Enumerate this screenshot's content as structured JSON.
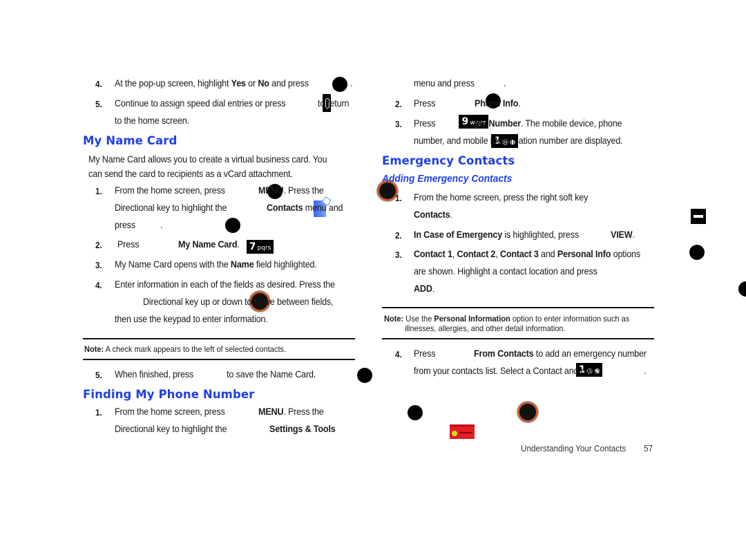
{
  "left_column": {
    "intro_steps": [
      {
        "number": "4.",
        "parts": [
          "At the pop-up screen, highlight ",
          "Yes",
          " or ",
          "No",
          " and press",
          "."
        ]
      },
      {
        "number": "5.",
        "line1": [
          "Continue to assign speed dial entries or press",
          "to return"
        ],
        "line2": "to the home screen."
      }
    ],
    "my_name_card": {
      "heading": "My Name Card",
      "intro_line1": "My Name Card allows you to create a virtual business card. You",
      "intro_line2": "can send the card to recipients as a vCard attachment.",
      "steps": [
        {
          "number": "1.",
          "line1_a": "From the home screen, press",
          "line1_b": "MENU",
          "line1_c": ". Press the",
          "line2_a": "Directional key to highlight the",
          "line2_b": "Contacts",
          "line2_c": " menu and",
          "line3": "press",
          "line3_end": "."
        },
        {
          "number": "2.",
          "a": "Press",
          "key_digit": "7",
          "key_letters": "pqrs",
          "b": "My Name Card",
          "c": "."
        },
        {
          "number": "3.",
          "a": "My Name Card opens with the ",
          "b": "Name",
          "c": " field highlighted."
        },
        {
          "number": "4.",
          "line1": "Enter information in each of the fields as desired. Press the",
          "line2": "Directional key up or down to move between fields,",
          "line3": "then use the keypad to enter information."
        }
      ],
      "note": {
        "label": "Note:",
        "text": " A check mark appears to the left of selected contacts."
      },
      "step5": {
        "number": "5.",
        "a": "When finished, press",
        "b": "to save the Name Card."
      }
    },
    "finding_number": {
      "heading": "Finding My Phone Number",
      "step1": {
        "number": "1.",
        "line1_a": "From the home screen, press",
        "line1_b": "MENU",
        "line1_c": ". Press the",
        "line2_a": "Directional key to highlight the",
        "line2_b": "Settings & Tools"
      }
    }
  },
  "right_column": {
    "continuation": {
      "a": "menu and press",
      "b": "."
    },
    "steps": [
      {
        "number": "2.",
        "a": "Press",
        "key_digit": "9",
        "key_letters": "wxyz",
        "b": "Phone Info",
        "c": "."
      },
      {
        "number": "3.",
        "a": "Press",
        "key_digit": "1",
        "key_letters": "@",
        "b": "My Number",
        "c": ". The mobile device, phone",
        "line2": "number, and mobile identification number are displayed."
      }
    ],
    "emergency": {
      "heading": "Emergency Contacts",
      "subheading": "Adding Emergency Contacts",
      "steps": [
        {
          "number": "1.",
          "line1": "From the home screen, press the right soft key",
          "line2": "Contacts",
          "line2_end": "."
        },
        {
          "number": "2.",
          "a": "In Case of Emergency",
          "b": " is highlighted, press",
          "c": "VIEW",
          "d": "."
        },
        {
          "number": "3.",
          "l1": [
            "Contact 1",
            ", ",
            "Contact 2",
            ", ",
            "Contact 3",
            " and ",
            "Personal Info",
            " options"
          ],
          "line2": "are shown. Highlight a contact location and press",
          "line3": "ADD",
          "line3_end": "."
        }
      ],
      "note": {
        "label": "Note:",
        "a": " Use the ",
        "b": "Personal Information",
        "c": " option to enter information such as",
        "line2": "illnesses, allergies, and other detail information."
      },
      "step4": {
        "number": "4.",
        "a": "Press",
        "key_digit": "1",
        "key_letters": "@",
        "b": "From Contacts",
        "c": " to add an emergency number",
        "line2": "from your contacts list. Select a Contact and press",
        "line2_end": "."
      }
    }
  },
  "footer": {
    "section": "Understanding Your Contacts",
    "page_number": "57"
  },
  "colors": {
    "heading": "#1f3fe8",
    "text": "#1a1a1a",
    "rule": "#111111",
    "dirkey_ring": "#d4581a"
  }
}
